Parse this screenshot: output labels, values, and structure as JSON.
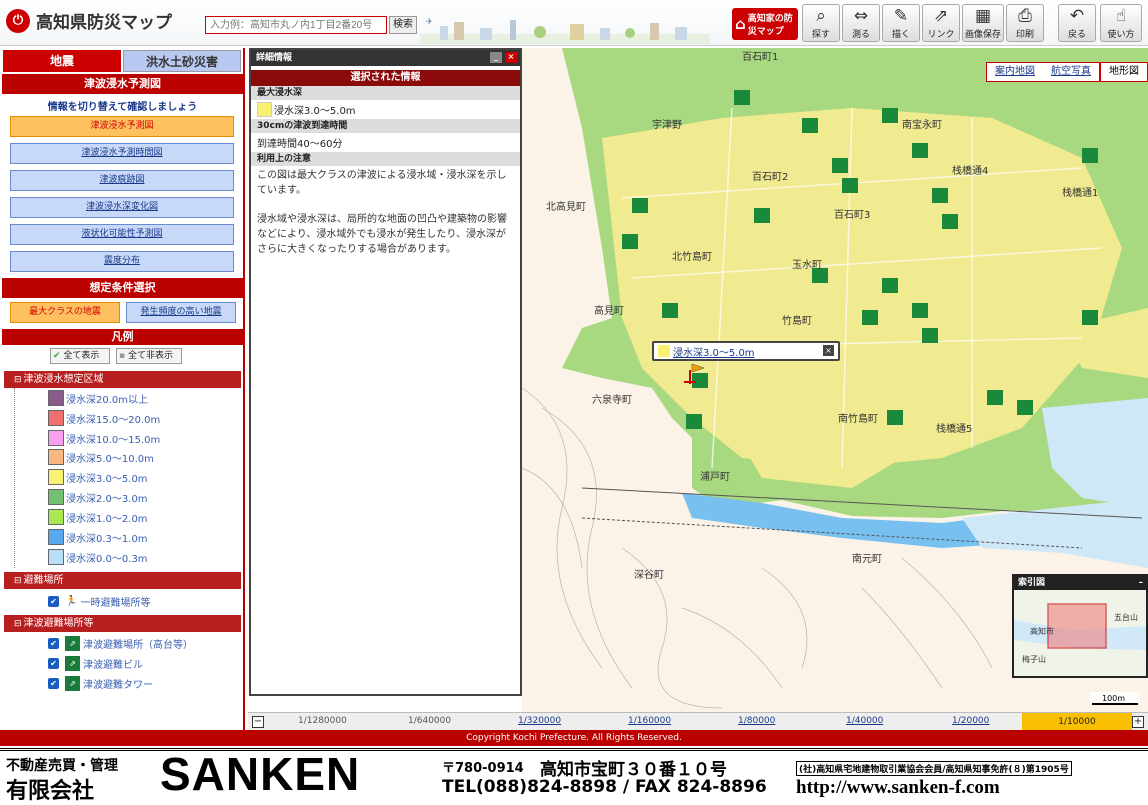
{
  "app": {
    "title": "高知県防災マップ",
    "search_placeholder": "入力例：高知市丸ノ内1丁目2番20号",
    "search_button": "検索"
  },
  "toolbar": {
    "home_label": "高知家の防災マップ",
    "buttons": [
      {
        "label": "探す",
        "icon": "magnifier-icon"
      },
      {
        "label": "測る",
        "icon": "ruler-icon"
      },
      {
        "label": "描く",
        "icon": "pencil-icon"
      },
      {
        "label": "リンク",
        "icon": "link-icon"
      },
      {
        "label": "画像保存",
        "icon": "save-image-icon"
      },
      {
        "label": "印刷",
        "icon": "printer-icon"
      },
      {
        "label": "戻る",
        "icon": "undo-icon"
      },
      {
        "label": "使い方",
        "icon": "help-icon"
      }
    ]
  },
  "left": {
    "tabs": [
      "地震",
      "洪水土砂災害"
    ],
    "section_title": "津波浸水予測図",
    "instruction": "情報を切り替えて確認しましょう",
    "views": [
      "津波浸水予測図",
      "津波浸水予測時間図",
      "津波痕跡図",
      "津波浸水深変化図",
      "液状化可能性予測図",
      "震度分布"
    ],
    "condition_title": "想定条件選択",
    "conditions": [
      "最大クラスの地震",
      "発生頻度の高い地震"
    ],
    "legend_title": "凡例",
    "show_all": "全て表示",
    "hide_all": "全て非表示",
    "legend_sections": [
      "津波浸水想定区域",
      "避難場所",
      "津波避難場所等"
    ],
    "depth_items": [
      {
        "label": "浸水深20.0m以上",
        "color": "#8a5a8a"
      },
      {
        "label": "浸水深15.0～20.0m",
        "color": "#f07070"
      },
      {
        "label": "浸水深10.0～15.0m",
        "color": "#f8a0f0"
      },
      {
        "label": "浸水深5.0～10.0m",
        "color": "#f8b880"
      },
      {
        "label": "浸水深3.0～5.0m",
        "color": "#f8f070"
      },
      {
        "label": "浸水深2.0～3.0m",
        "color": "#70c070"
      },
      {
        "label": "浸水深1.0～2.0m",
        "color": "#a8e850"
      },
      {
        "label": "浸水深0.3～1.0m",
        "color": "#58a8f0"
      },
      {
        "label": "浸水深0.0～0.3m",
        "color": "#b8e0f8"
      }
    ],
    "shelter_items": [
      "一時避難場所等"
    ],
    "tsunami_shelter_items": [
      "津波避難場所（高台等）",
      "津波避難ビル",
      "津波避難タワー"
    ]
  },
  "detail": {
    "title": "詳細情報",
    "selected": "選択された情報",
    "rows": [
      {
        "head": "最大浸水深",
        "value": "浸水深3.0～5.0m"
      },
      {
        "head": "30cmの津波到達時間",
        "value": "到達時間40～60分"
      }
    ],
    "note_head": "利用上の注意",
    "note1": "この図は最大クラスの津波による浸水域・浸水深を示しています。",
    "note2": "浸水域や浸水深は、局所的な地面の凹凸や建築物の影響などにより、浸水域外でも浸水が発生したり、浸水深がさらに大きくなったりする場合があります。"
  },
  "map": {
    "tabs": [
      "案内地図",
      "航空写真",
      "地形図"
    ],
    "popup": "浸水深3.0～5.0m",
    "index_title": "索引図",
    "scale_label": "100m",
    "place_labels": [
      "百石町1",
      "北高見町",
      "北竹島町",
      "高見町",
      "竹島町",
      "南竹島町",
      "栈橋通5",
      "浦戸町",
      "深谷町",
      "南元町",
      "六泉寺町",
      "百石町2",
      "百石町3",
      "栈橋通4",
      "栈橋通1",
      "宇津野",
      "南宝永町",
      "玉水町"
    ],
    "index_labels": [
      "高知市",
      "梅子山",
      "五台山"
    ]
  },
  "scales": [
    "1/1280000",
    "1/640000",
    "1/320000",
    "1/160000",
    "1/80000",
    "1/40000",
    "1/20000",
    "1/10000"
  ],
  "copyright": "Copyright Kochi Prefecture. All Rights Reserved.",
  "banner": {
    "line1": "不動産売買・管理",
    "line2": "有限会社",
    "name": "SANKEN",
    "postal": "〒780-0914",
    "address": "高知市宝町３０番１０号",
    "tel": "TEL(088)824-8898 / FAX 824-8896",
    "assoc": "(社)高知県宅地建物取引業協会会員/高知県知事免許(８)第1905号",
    "url": "http://www.sanken-f.com"
  }
}
